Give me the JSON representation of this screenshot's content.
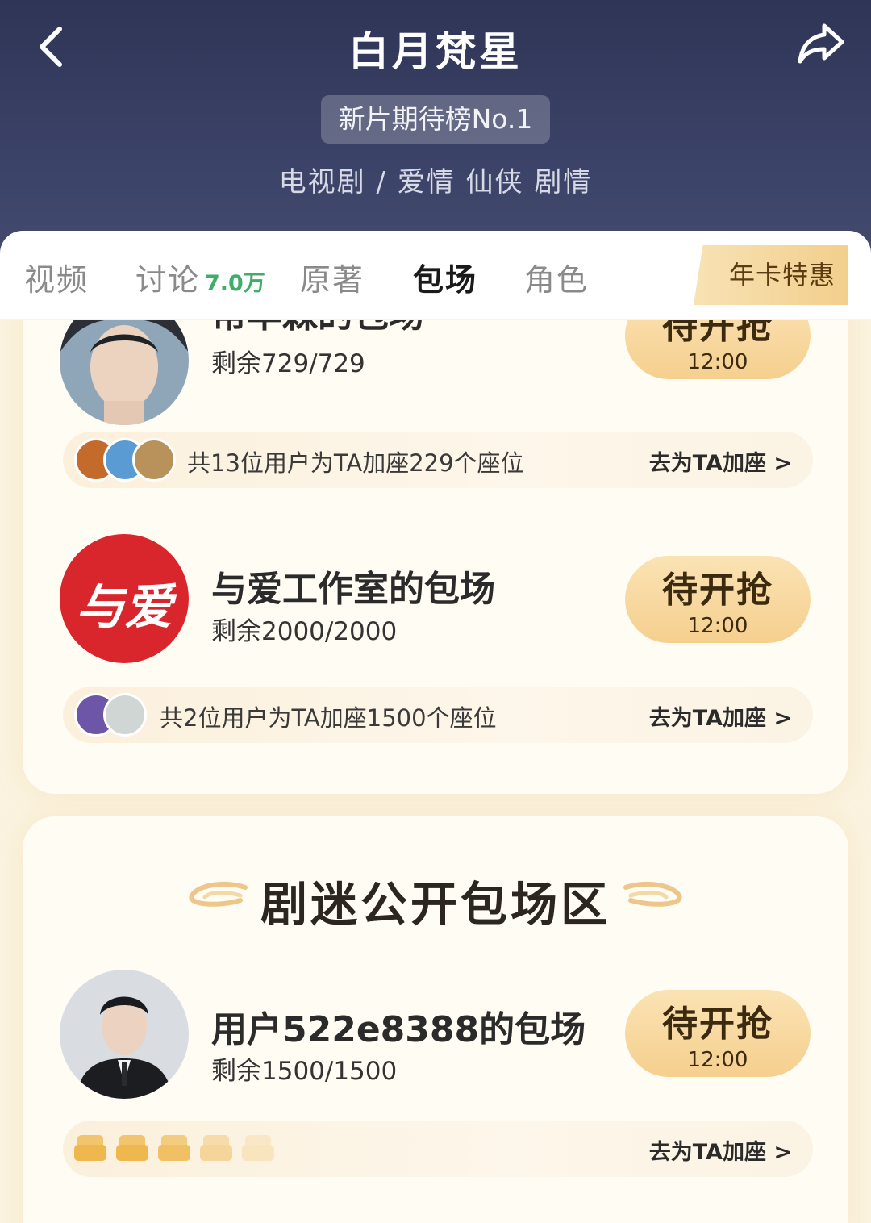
{
  "header": {
    "title": "白月梵星",
    "rank_badge": "新片期待榜No.1",
    "genre": "电视剧 / 爱情 仙侠 剧情"
  },
  "tabs": [
    {
      "label": "视频"
    },
    {
      "label": "讨论",
      "count": "7.0万"
    },
    {
      "label": "原著"
    },
    {
      "label": "包场",
      "active": true
    },
    {
      "label": "角色"
    }
  ],
  "promo": "年卡特惠",
  "sessions": [
    {
      "title": "常华森的包场",
      "remain": "剩余729/729",
      "button": "待开抢",
      "time": "12:00",
      "seat_text": "共13位用户为TA加座229个座位",
      "add_seat": "去为TA加座 >"
    },
    {
      "title": "与爱工作室的包场",
      "avatar_text": "与爱",
      "remain": "剩余2000/2000",
      "button": "待开抢",
      "time": "12:00",
      "seat_text": "共2位用户为TA加座1500个座位",
      "add_seat": "去为TA加座 >"
    }
  ],
  "public_section": {
    "title": "剧迷公开包场区",
    "sessions": [
      {
        "title": "用户522e8388的包场",
        "remain": "剩余1500/1500",
        "button": "待开抢",
        "time": "12:00",
        "add_seat": "去为TA加座 >"
      }
    ]
  },
  "colors": {
    "header_bg": "#3b4267",
    "accent_gold": "#f5cf8e",
    "count_green": "#3fae6b",
    "page_bg": "#fbf3df"
  }
}
